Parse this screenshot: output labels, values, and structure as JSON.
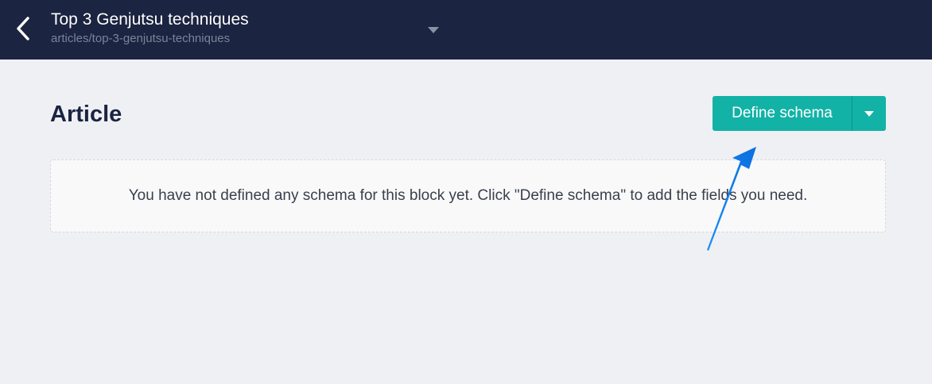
{
  "header": {
    "title": "Top 3 Genjutsu techniques",
    "slug": "articles/top-3-genjutsu-techniques",
    "back_icon": "chevron-left-icon",
    "dropdown_icon": "caret-down-icon"
  },
  "main": {
    "heading": "Article",
    "define_schema_label": "Define schema",
    "empty_message": "You have not defined any schema for this block yet. Click \"Define schema\" to add the fields you need."
  },
  "colors": {
    "topbar": "#1b2440",
    "background": "#eff0f4",
    "accent": "#12b2a6",
    "annotation_arrow": "#1e8df7"
  }
}
